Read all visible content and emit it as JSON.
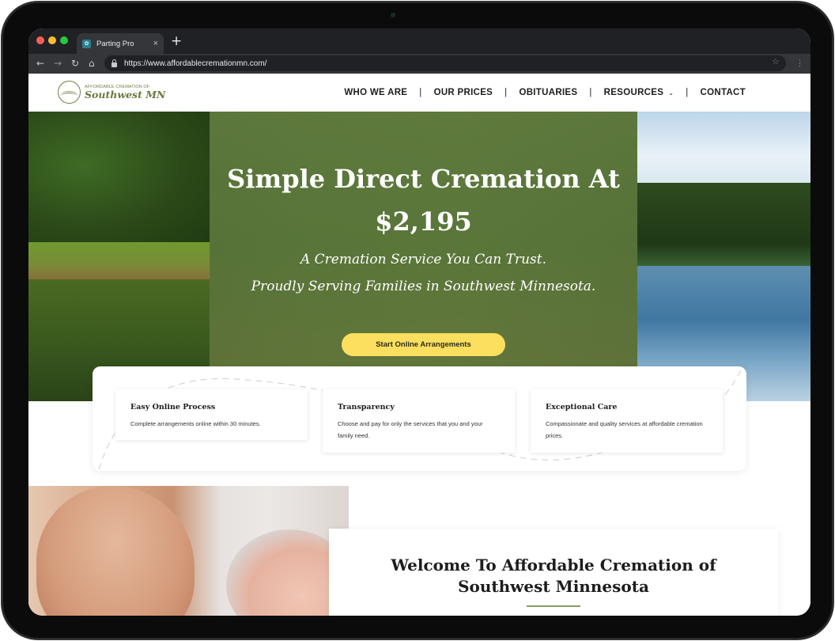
{
  "browser": {
    "tab_title": "Parting Pro",
    "tab_close": "×",
    "new_tab": "+",
    "url": "https://www.affordablecremationmn.com/",
    "icons": {
      "back": "←",
      "forward": "→",
      "reload": "↻",
      "home": "⌂",
      "bookmark": "☆",
      "menu": "⋮"
    }
  },
  "site": {
    "logo": {
      "small": "AFFORDABLE CREMATION OF",
      "big": "Southwest MN"
    },
    "nav": {
      "items": [
        {
          "label": "WHO WE ARE"
        },
        {
          "label": "OUR PRICES"
        },
        {
          "label": "OBITUARIES"
        },
        {
          "label": "RESOURCES",
          "has_dropdown": true
        },
        {
          "label": "CONTACT"
        }
      ],
      "separator": "|",
      "dropdown_icon": "⌄"
    },
    "hero": {
      "title_line1": "Simple Direct Cremation At",
      "title_line2": "$2,195",
      "subtitle_line1": "A Cremation Service You Can Trust.",
      "subtitle_line2": "Proudly Serving Families in Southwest Minnesota.",
      "cta_label": "Start Online Arrangements",
      "cta_color": "#fcdf5f",
      "overlay_color": "#5f7a3e"
    },
    "features": [
      {
        "title": "Easy Online Process",
        "text": "Complete arrangements online within 30 minutes."
      },
      {
        "title": "Transparency",
        "text": "Choose and pay for only the services that you and your family need."
      },
      {
        "title": "Exceptional Care",
        "text": "Compassionate and quality services at affordable cremation prices."
      }
    ],
    "welcome": {
      "title": "Welcome To Affordable Cremation of Southwest Minnesota",
      "accent_color": "#8a9a63"
    }
  }
}
